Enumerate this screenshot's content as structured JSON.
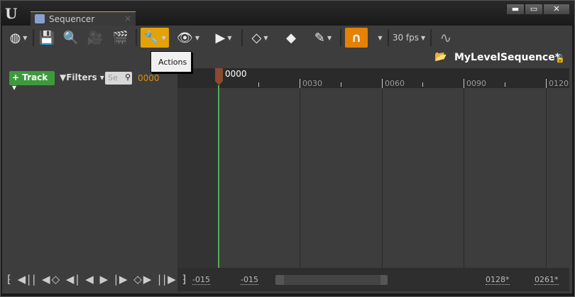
{
  "window": {
    "tab_title": "Sequencer",
    "minimize": "▬",
    "maximize": "▭",
    "close": "✕",
    "logo": "U"
  },
  "toolbar": {
    "items": [
      {
        "name": "world-icon",
        "glyph": "◍"
      },
      {
        "name": "save-icon",
        "glyph": "💾"
      },
      {
        "name": "search-icon",
        "glyph": "🔍"
      },
      {
        "name": "camera-icon",
        "glyph": "🎥"
      },
      {
        "name": "clapper-icon",
        "glyph": "🎬"
      },
      {
        "name": "wrench-icon",
        "glyph": "🔧"
      },
      {
        "name": "eye-icon",
        "glyph": "👁"
      },
      {
        "name": "play-icon",
        "glyph": "▶"
      },
      {
        "name": "key-icon",
        "glyph": "◇"
      },
      {
        "name": "key-tag-icon",
        "glyph": "◆"
      },
      {
        "name": "pencil-icon",
        "glyph": "✎"
      },
      {
        "name": "magnet-icon",
        "glyph": "∩"
      }
    ],
    "fps": "30 fps",
    "curve_icon": "∿"
  },
  "tooltip": {
    "text": "Actions"
  },
  "sequence": {
    "name": "MyLevelSequence*"
  },
  "left_panel": {
    "track_label": "Track",
    "filters_label": "Filters",
    "search_placeholder": "Se",
    "current_time": "0000"
  },
  "timeline": {
    "playhead_label": "0000",
    "ticks": [
      "0030",
      "0060",
      "0090",
      "0120"
    ],
    "range_start_view": "-015",
    "range_start": "-015",
    "range_end": "0128*",
    "range_end_view": "0261*"
  },
  "transport": {
    "glyphs": "⁅ ◀|| ◀◇ ◀| ◀ ▶ |▶ ◇▶ ||▶ ⁆"
  },
  "colors": {
    "accent_actions": "#e3a206",
    "snap": "#e38206",
    "track_button": "#3c9a3c",
    "playhead": "#8a4a30",
    "time": "#e08a10"
  }
}
